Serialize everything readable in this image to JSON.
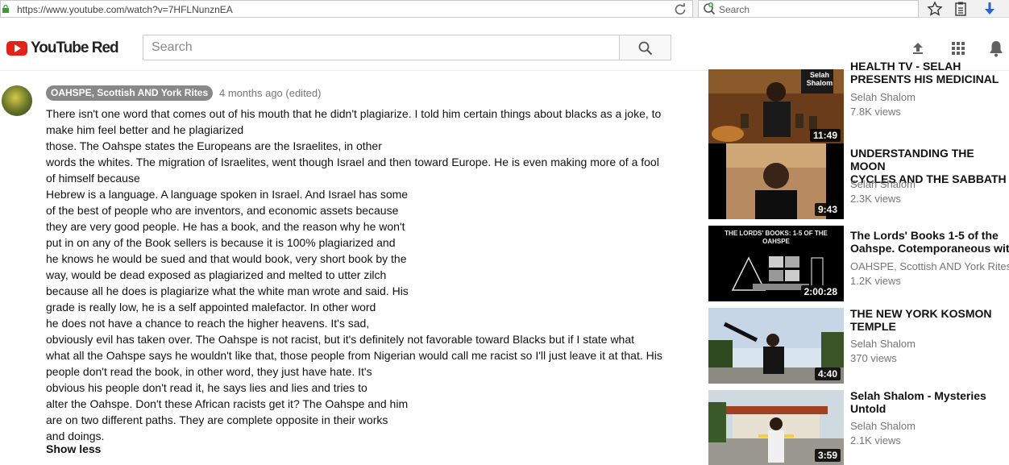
{
  "browser": {
    "url": "https://www.youtube.com/watch?v=7HFLNunznEA",
    "search_placeholder": "Search"
  },
  "header": {
    "logo_text": "YouTube Red",
    "search_placeholder": "Search"
  },
  "comment": {
    "author": "OAHSPE, Scottish AND York Rites",
    "time": "4 months ago (edited)",
    "lines": [
      "There isn't one word that comes out of his mouth that he didn't plagiarize. I told him certain things about blacks as a joke, to",
      "make him feel better and he plagiarized",
      " those. The Oahspe states the Europeans are the Israelites, in other",
      "words the whites. The migration of Israelites, went though Israel and then toward Europe. He is even making more of a fool",
      "of himself because",
      "Hebrew is a language. A language spoken in Israel. And Israel has some",
      "of the best of people who are inventors, and economic assets because",
      "they are very good people. He has a book, and the reason why he won't",
      "put in on any of the Book sellers is because it is 100% plagiarized and",
      "he knows he would be sued and that would  book, very short book by the",
      "way, would be dead exposed as plagiarized and melted to utter zilch",
      "because all he does is plagiarize what the white man wrote and said. His",
      " grade is really low, he is a self appointed malefactor. In other word",
      "he does not have a chance to reach the higher heavens. It's sad,",
      "obviously evil has taken over. The Oahspe is not racist, but it's definitely not favorable toward Blacks but if I state what",
      "what all the Oahspe says he wouldn't like that, those people from Nigerian would call me racist so I'll just leave it at that. His",
      "people don't read the book, in other word, they just have hate. It's",
      " obvious his people don't read it, he says lies and lies and tries to",
      "alter the Oahspe. Don't these African racists get it? The Oahspe and him",
      " are on two different paths. They are complete opposite in their works",
      "and doings."
    ],
    "show_less": "Show less"
  },
  "related": [
    {
      "title_lines": [
        "HEALTH TV - SELAH",
        "PRESENTS HIS MEDICINAL"
      ],
      "channel": "Selah Shalom",
      "views": "7.8K views",
      "duration": "11:49",
      "thumb_text": "Selah Shalom"
    },
    {
      "title_lines": [
        "UNDERSTANDING THE MOON",
        "CYCLES AND THE SABBATH"
      ],
      "channel": "Selah Shalom",
      "views": "2.3K views",
      "duration": "9:43"
    },
    {
      "title_lines": [
        "The Lords' Books 1-5 of the",
        "Oahspe. Cotemporaneous with"
      ],
      "channel": "OAHSPE, Scottish AND York Rites",
      "views": "1.2K views",
      "duration": "2:00:28",
      "thumb_text": "THE LORDS' BOOKS: 1-5 OF THE OAHSPE"
    },
    {
      "title_lines": [
        "THE NEW YORK KOSMON",
        "TEMPLE"
      ],
      "channel": "Selah Shalom",
      "views": "370 views",
      "duration": "4:40"
    },
    {
      "title_lines": [
        "Selah Shalom - Mysteries",
        "Untold"
      ],
      "channel": "Selah Shalom",
      "views": "2.1K views",
      "duration": "3:59"
    }
  ]
}
